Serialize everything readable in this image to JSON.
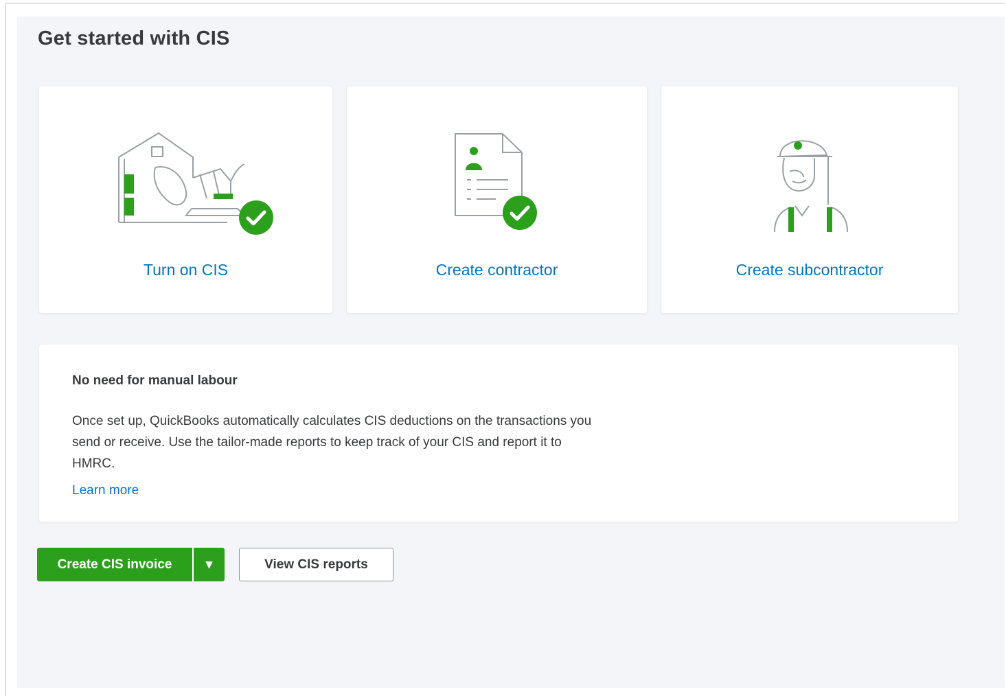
{
  "page": {
    "title": "Get started with CIS"
  },
  "cards": [
    {
      "label": "Turn on CIS",
      "icon": "construction-vehicle-icon",
      "completed": true
    },
    {
      "label": "Create contractor",
      "icon": "contractor-document-icon",
      "completed": true
    },
    {
      "label": "Create subcontractor",
      "icon": "subcontractor-worker-icon",
      "completed": false
    }
  ],
  "info": {
    "heading": "No need for manual labour",
    "body": "Once set up, QuickBooks automatically calculates CIS deductions on the transactions you send or receive. Use the tailor-made reports to keep track of your CIS and report it to HMRC.",
    "link": "Learn more"
  },
  "actions": {
    "primary_label": "Create CIS invoice",
    "caret_glyph": "▼",
    "secondary_label": "View CIS reports"
  },
  "colors": {
    "brand_green": "#2ca01c",
    "link_blue": "#0077c5",
    "text_dark": "#393a3d",
    "panel_bg": "#f3f5f8"
  }
}
